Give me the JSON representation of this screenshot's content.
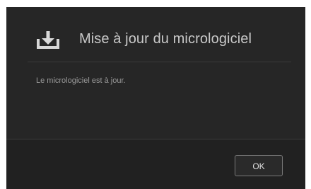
{
  "dialog": {
    "title": "Mise à jour du micrologiciel",
    "icon": "download-icon",
    "message": "Le micrologiciel est à jour.",
    "ok_label": "OK"
  },
  "colors": {
    "background": "#262626",
    "footer": "#212121",
    "title_text": "#c9c9c9",
    "body_text": "#9a9a9a",
    "button_border": "#7a7a7a"
  }
}
